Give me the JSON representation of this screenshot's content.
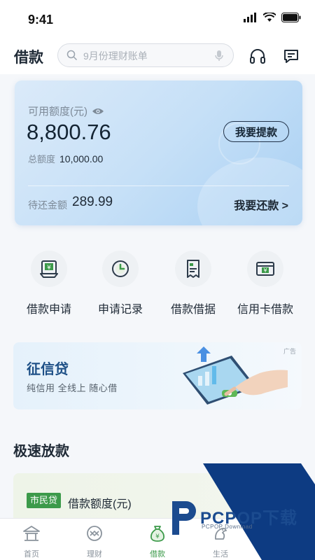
{
  "status_bar": {
    "time": "9:41"
  },
  "header": {
    "title": "借款",
    "search_placeholder": "9月份理财账单"
  },
  "credit_card": {
    "available_label": "可用额度(元)",
    "available_amount": "8,800.76",
    "withdraw_button": "我要提款",
    "total_label": "总额度",
    "total_amount": "10,000.00",
    "repay_label": "待还金额",
    "repay_amount": "289.99",
    "repay_button": "我要还款 >"
  },
  "quick_menu": [
    {
      "label": "借款申请",
      "icon": "loan-apply-icon"
    },
    {
      "label": "申请记录",
      "icon": "clock-icon"
    },
    {
      "label": "借款借据",
      "icon": "receipt-icon"
    },
    {
      "label": "信用卡借款",
      "icon": "credit-card-icon"
    }
  ],
  "banner": {
    "title": "征信贷",
    "subtitle": "纯信用  全线上  随心借",
    "ad_tag": "广告"
  },
  "section": {
    "title": "极速放款"
  },
  "loan_card": {
    "badge": "市民贷",
    "label": "借款额度(元)"
  },
  "tab_bar": [
    {
      "label": "首页",
      "icon": "home-temple-icon"
    },
    {
      "label": "理财",
      "icon": "finance-icon"
    },
    {
      "label": "借款",
      "icon": "money-bag-icon",
      "active": true
    },
    {
      "label": "生活",
      "icon": "life-icon"
    }
  ],
  "watermark": {
    "text": "PCPOP下载",
    "sub": "PCPOP Download"
  },
  "colors": {
    "accent_green": "#3c9a4a",
    "card_blue": "#c6e0f7",
    "banner_title_blue": "#1d4f86"
  }
}
